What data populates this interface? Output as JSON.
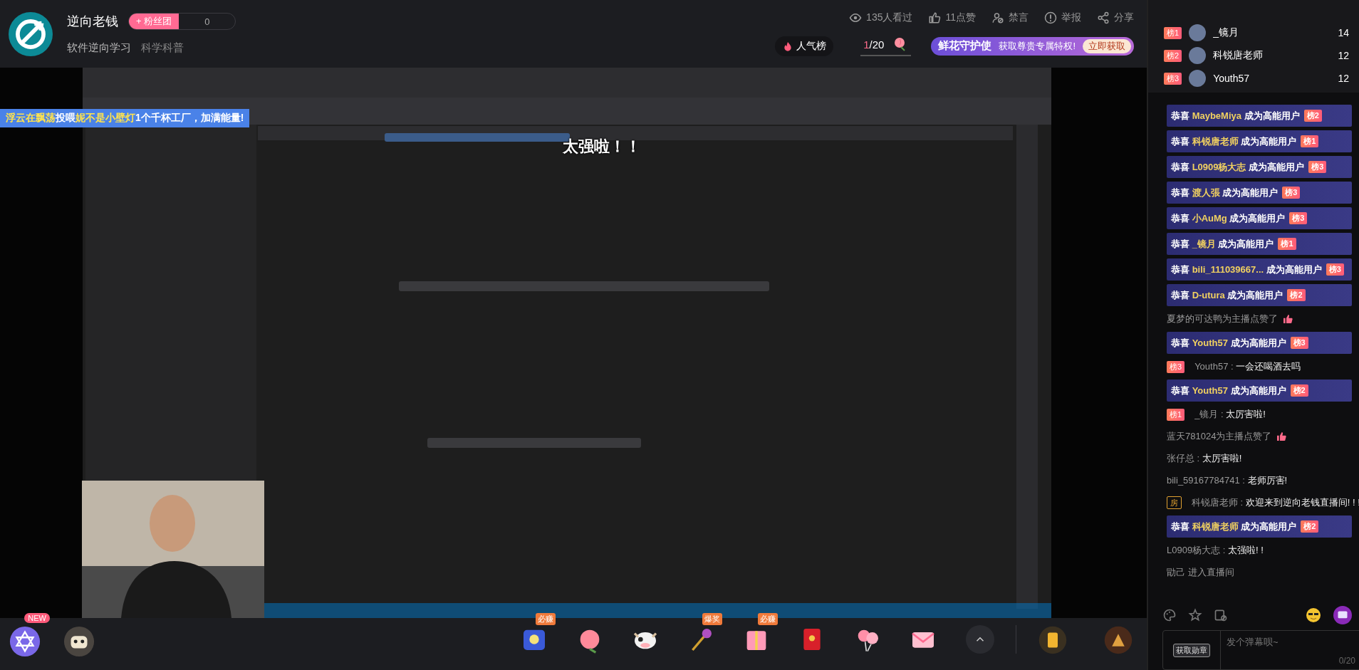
{
  "streamer": {
    "name": "逆向老钱",
    "fan_club_button": "+ 粉丝团",
    "fan_club_count": "0",
    "tags": [
      "软件逆向学习",
      "科学科普"
    ]
  },
  "stats": [
    {
      "kind": "views",
      "text": "135人看过"
    },
    {
      "kind": "likes",
      "text": "11点赞"
    },
    {
      "kind": "mute",
      "text": "禁言"
    },
    {
      "kind": "report",
      "text": "举报"
    },
    {
      "kind": "share",
      "text": "分享"
    }
  ],
  "popularity": {
    "label": "人气榜"
  },
  "flower": {
    "count": "1",
    "total": "/20"
  },
  "guardian_banner": {
    "title": "鲜花守护使",
    "text": "获取尊贵专属特权!",
    "button": "立即获取"
  },
  "player": {
    "kind": "picture",
    "overlay_banner": [
      {
        "text": "浮云在飘荡",
        "highlight": true
      },
      {
        "text": "投喂",
        "highlight": false
      },
      {
        "text": "妮不是小壁灯",
        "highlight": true
      },
      {
        "text": "1个千杯工厂，加满能量!",
        "highlight": false
      }
    ],
    "danmaku": [
      {
        "text": "太强啦！！"
      }
    ]
  },
  "bottom_bar": {
    "activities": [
      {
        "kind": "star",
        "badge": "NEW"
      },
      {
        "kind": "robot"
      }
    ],
    "gifts": [
      {
        "kind": "blind-box",
        "badge": "必赚"
      },
      {
        "kind": "peach"
      },
      {
        "kind": "cow"
      },
      {
        "kind": "wand",
        "badge": "爆奖"
      },
      {
        "kind": "gift-box",
        "badge": "必赚"
      },
      {
        "kind": "envelope"
      },
      {
        "kind": "balloons"
      },
      {
        "kind": "letter"
      }
    ]
  },
  "rank_list": [
    {
      "badge": "榜1",
      "name": "_镜月",
      "score": "14"
    },
    {
      "badge": "榜2",
      "name": "科锐唐老师",
      "score": "12"
    },
    {
      "badge": "榜3",
      "name": "Youth57",
      "score": "12"
    }
  ],
  "chat": [
    {
      "kind": "notice",
      "user": "MaybeMiya",
      "text": "成为高能用户",
      "prefix": "恭喜",
      "badge": "榜2"
    },
    {
      "kind": "notice",
      "prefix": "恭喜",
      "user": "科锐唐老师",
      "text": "成为高能用户",
      "badge": "榜1"
    },
    {
      "kind": "notice",
      "prefix": "恭喜",
      "user": "L0909杨大志",
      "text": "成为高能用户",
      "badge": "榜3"
    },
    {
      "kind": "notice",
      "prefix": "恭喜",
      "user": "渡人張",
      "text": "成为高能用户",
      "badge": "榜3"
    },
    {
      "kind": "notice",
      "prefix": "恭喜",
      "user": "小AuMg",
      "text": "成为高能用户",
      "badge": "榜3"
    },
    {
      "kind": "notice",
      "prefix": "恭喜",
      "user": "_镜月",
      "text": "成为高能用户",
      "badge": "榜1"
    },
    {
      "kind": "notice",
      "prefix": "恭喜",
      "user": "bili_111039667...",
      "text": "成为高能用户",
      "badge": "榜3"
    },
    {
      "kind": "notice",
      "prefix": "恭喜",
      "user": "D-utura",
      "text": "成为高能用户",
      "badge": "榜2"
    },
    {
      "kind": "like",
      "text": "夏梦的可达鸭为主播点赞了"
    },
    {
      "kind": "notice",
      "prefix": "恭喜",
      "user": "Youth57",
      "text": "成为高能用户",
      "badge": "榜3"
    },
    {
      "kind": "comment",
      "badge": {
        "kind": "rank",
        "text": "榜3"
      },
      "user": "Youth57 : ",
      "text": "一会还喝酒去吗"
    },
    {
      "kind": "notice",
      "prefix": "恭喜",
      "user": "Youth57",
      "text": "成为高能用户",
      "badge": "榜2"
    },
    {
      "kind": "comment",
      "badge": {
        "kind": "rank",
        "text": "榜1"
      },
      "user": "_镜月 : ",
      "text": "太厉害啦!"
    },
    {
      "kind": "like",
      "text": "蓝天781024为主播点赞了"
    },
    {
      "kind": "comment",
      "user": "张仔总 : ",
      "text": "太厉害啦!"
    },
    {
      "kind": "comment",
      "user": "bili_59167784741 : ",
      "text": "老师厉害!"
    },
    {
      "kind": "comment",
      "badge": {
        "kind": "admin",
        "text": "房"
      },
      "user": "科锐唐老师 : ",
      "text": "欢迎来到逆向老钱直播间! ! !"
    },
    {
      "kind": "notice",
      "prefix": "恭喜",
      "user": "科锐唐老师",
      "text": "成为高能用户",
      "badge": "榜2"
    },
    {
      "kind": "comment",
      "user": "L0909杨大志 : ",
      "text": "太强啦! !"
    },
    {
      "kind": "enter",
      "text": "勖己 进入直播间"
    }
  ],
  "chat_input": {
    "medal_button": "获取勋章",
    "placeholder": "发个弹幕呗~",
    "counter": "0/20"
  }
}
